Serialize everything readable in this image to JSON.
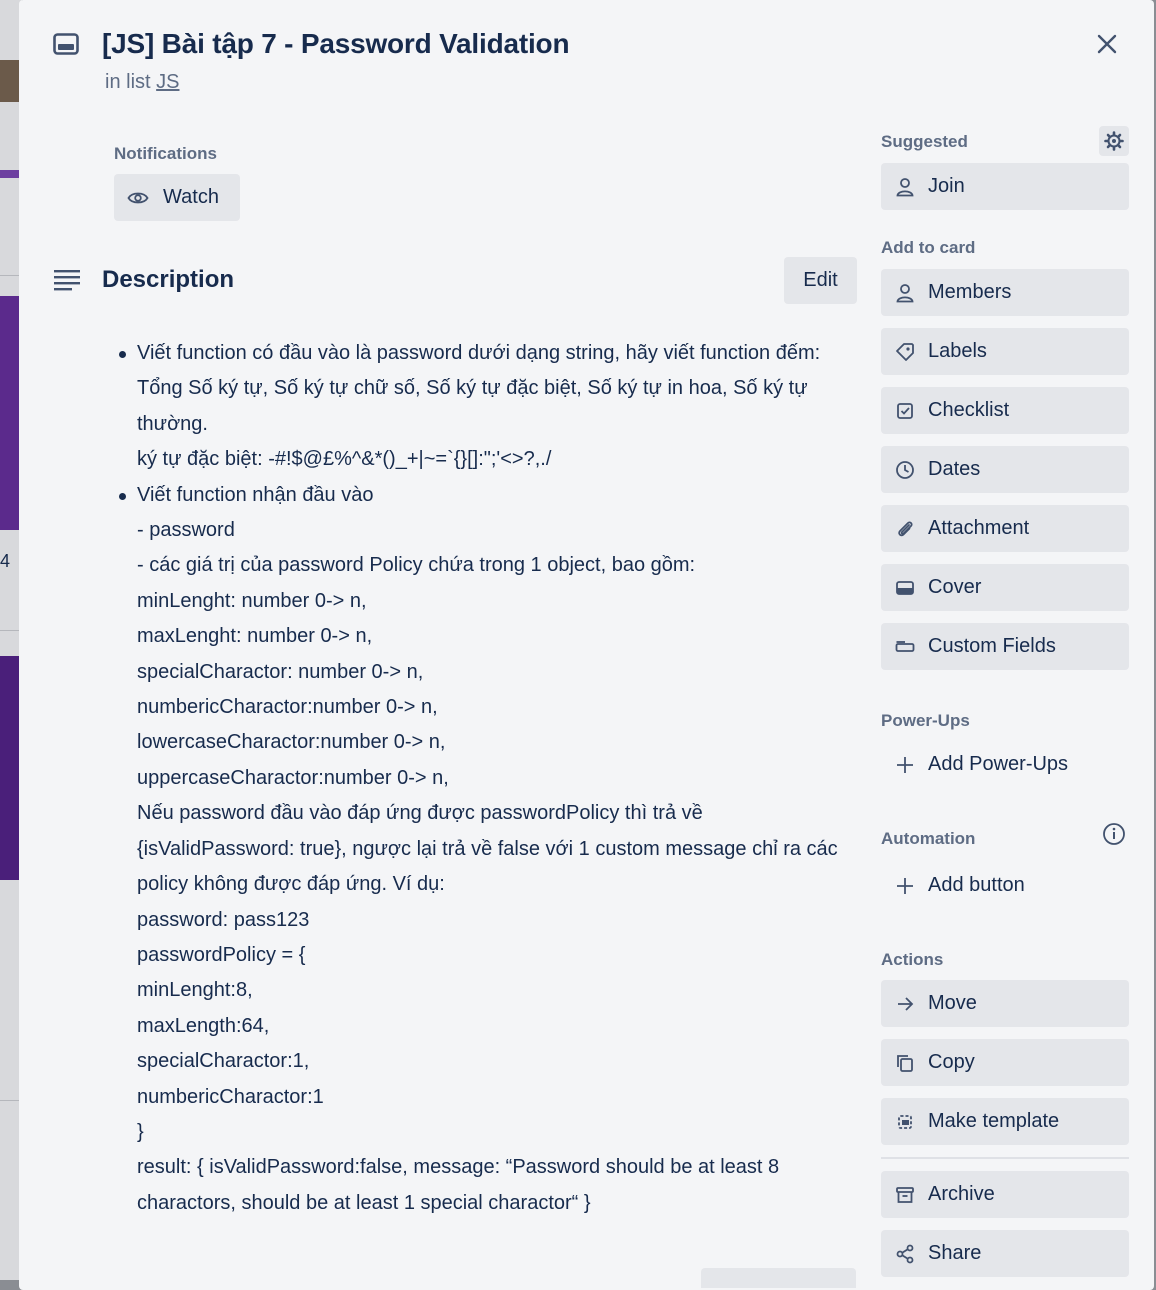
{
  "card": {
    "title": "[JS] Bài tập 7 - Password Validation",
    "list_prefix": "in list",
    "list_name": "JS"
  },
  "notifications": {
    "label": "Notifications",
    "watch_label": "Watch"
  },
  "description": {
    "heading": "Description",
    "edit_label": "Edit",
    "item1": {
      "text": "Viết function có đầu vào là password dưới dạng string, hãy viết function đếm: Tổng Số ký tự, Số ký tự chữ số, Số ký tự đặc biệt, Số ký tự in hoa, Số ký tự thường.",
      "special": "ký tự đặc biệt: -#!$@£%^&*()_+|~=`{}[]:\";'<>?,./"
    },
    "item2_lines": [
      "Viết function nhận đầu vào",
      "- password",
      "- các giá trị của password Policy chứa trong 1 object, bao gồm:",
      "minLenght: number 0-> n,",
      "maxLenght: number 0-> n,",
      "specialCharactor: number 0-> n,",
      "numbericCharactor:number 0-> n,",
      "lowercaseCharactor:number 0-> n,",
      "uppercaseCharactor:number 0-> n,"
    ],
    "item2_paragraph": "Nếu password đầu vào đáp ứng được passwordPolicy thì trả về {isValidPassword: true}, ngược lại trả về false với 1 custom message chỉ ra các policy không được đáp ứng. Ví dụ:",
    "item2_example": [
      "password: pass123",
      "passwordPolicy = {",
      "minLenght:8,",
      "maxLength:64,",
      "specialCharactor:1,",
      "numbericCharactor:1",
      "}"
    ],
    "item2_result": "result: { isValidPassword:false, message: “Password should be at least 8 charactors, should be at least 1 special charactor“ }"
  },
  "sidebar": {
    "suggested_label": "Suggested",
    "join_label": "Join",
    "add_to_card_label": "Add to card",
    "add_to_card": [
      "Members",
      "Labels",
      "Checklist",
      "Dates",
      "Attachment",
      "Cover",
      "Custom Fields"
    ],
    "powerups_label": "Power-Ups",
    "add_powerups_label": "Add Power-Ups",
    "automation_label": "Automation",
    "add_button_label": "Add button",
    "actions_label": "Actions",
    "actions": [
      "Move",
      "Copy",
      "Make template",
      "Archive",
      "Share"
    ]
  },
  "background": {
    "visible_number": "4"
  }
}
